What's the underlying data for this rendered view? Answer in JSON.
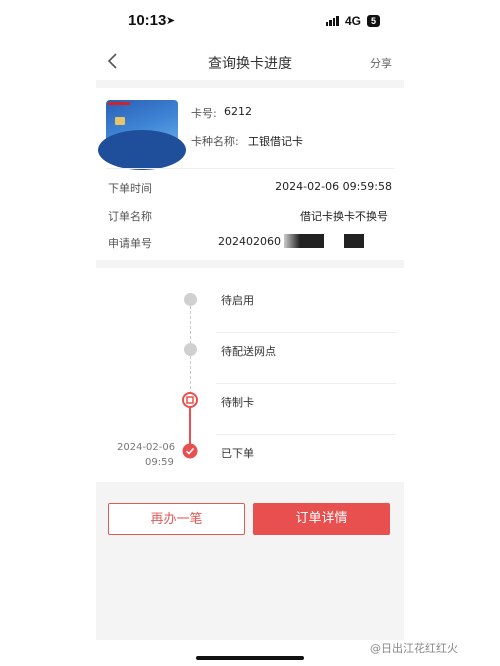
{
  "status_bar": {
    "time": "10:13",
    "network": "4G",
    "battery": "5"
  },
  "header": {
    "title": "查询换卡进度",
    "back_icon": "chevron-left-icon",
    "share_label": "分享"
  },
  "card": {
    "number_label": "卡号:",
    "number_value": "6212",
    "type_label": "卡种名称:",
    "type_value": "工银借记卡"
  },
  "order": {
    "rows": [
      {
        "label": "下单时间",
        "value": "2024-02-06 09:59:58"
      },
      {
        "label": "订单名称",
        "value": "借记卡换卡不换号"
      },
      {
        "label": "申请单号",
        "value": "202402060"
      }
    ]
  },
  "timeline": {
    "steps": [
      {
        "label": "待启用",
        "status": "pending"
      },
      {
        "label": "待配送网点",
        "status": "pending"
      },
      {
        "label": "待制卡",
        "status": "current"
      },
      {
        "label": "已下单",
        "status": "done",
        "date": "2024-02-06",
        "time": "09:59"
      }
    ]
  },
  "actions": {
    "again_label": "再办一笔",
    "detail_label": "订单详情"
  },
  "watermark": "@日出江花红红火",
  "colors": {
    "accent": "#e8504f",
    "card_blue": "#3f86d6"
  }
}
